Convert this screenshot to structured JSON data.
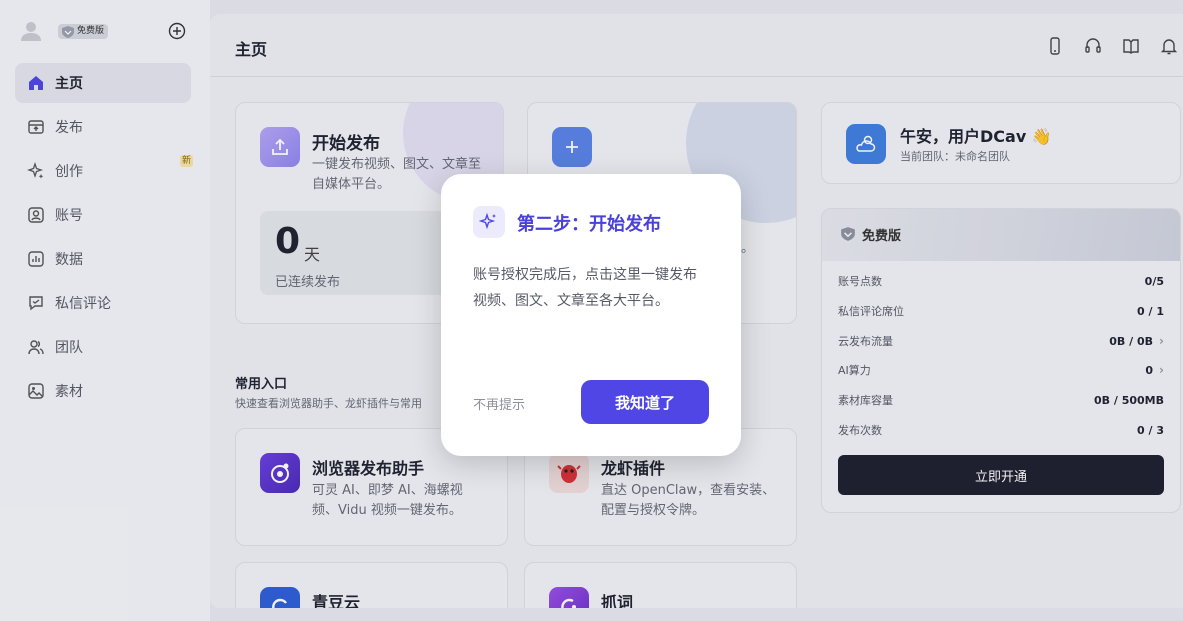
{
  "sidebar": {
    "plan_badge": "免费版",
    "items": [
      {
        "label": "主页",
        "icon": "home-icon",
        "active": true
      },
      {
        "label": "发布",
        "icon": "publish-icon"
      },
      {
        "label": "创作",
        "icon": "sparkle-icon",
        "badge": "新"
      },
      {
        "label": "账号",
        "icon": "account-icon"
      },
      {
        "label": "数据",
        "icon": "chart-icon"
      },
      {
        "label": "私信评论",
        "icon": "message-icon"
      },
      {
        "label": "团队",
        "icon": "team-icon"
      },
      {
        "label": "素材",
        "icon": "assets-icon"
      }
    ]
  },
  "header": {
    "title": "主页",
    "icons": [
      "phone-icon",
      "headset-icon",
      "book-icon",
      "bell-icon"
    ]
  },
  "publish_card": {
    "title": "开始发布",
    "desc": "一键发布视频、图文、文章至自媒体平台。",
    "streak_value": "0",
    "streak_unit": "天",
    "streak_label": "已连续发布"
  },
  "second_card": {
    "desc_visible": "理。"
  },
  "greeting": {
    "title": "午安，用户DCav 👋",
    "subtitle": "当前团队：未命名团队"
  },
  "plan_card": {
    "name": "免费版",
    "rows": [
      {
        "label": "账号点数",
        "value": "0/5"
      },
      {
        "label": "私信评论席位",
        "value": "0 / 1"
      },
      {
        "label": "云发布流量",
        "value": "0B / 0B",
        "chevron": true
      },
      {
        "label": "AI算力",
        "value": "0",
        "chevron": true
      },
      {
        "label": "素材库容量",
        "value": "0B / 500MB"
      },
      {
        "label": "发布次数",
        "value": "0 / 3"
      }
    ],
    "button": "立即开通"
  },
  "common_entries": {
    "title": "常用入口",
    "desc": "快速查看浏览器助手、龙虾插件与常用",
    "cards": [
      {
        "title": "浏览器发布助手",
        "desc": "可灵 AI、即梦 AI、海螺视频、Vidu 视频一键发布。"
      },
      {
        "title": "龙虾插件",
        "desc": "直达 OpenClaw，查看安装、配置与授权令牌。"
      },
      {
        "title": "青豆云",
        "desc": ""
      },
      {
        "title": "抓词",
        "desc": ""
      }
    ]
  },
  "modal": {
    "title": "第二步：开始发布",
    "body": "账号授权完成后，点击这里一键发布视频、图文、文章至各大平台。",
    "skip": "不再提示",
    "confirm": "我知道了"
  },
  "colors": {
    "accent": "#4f46e5",
    "dark_button": "#1e2030"
  }
}
